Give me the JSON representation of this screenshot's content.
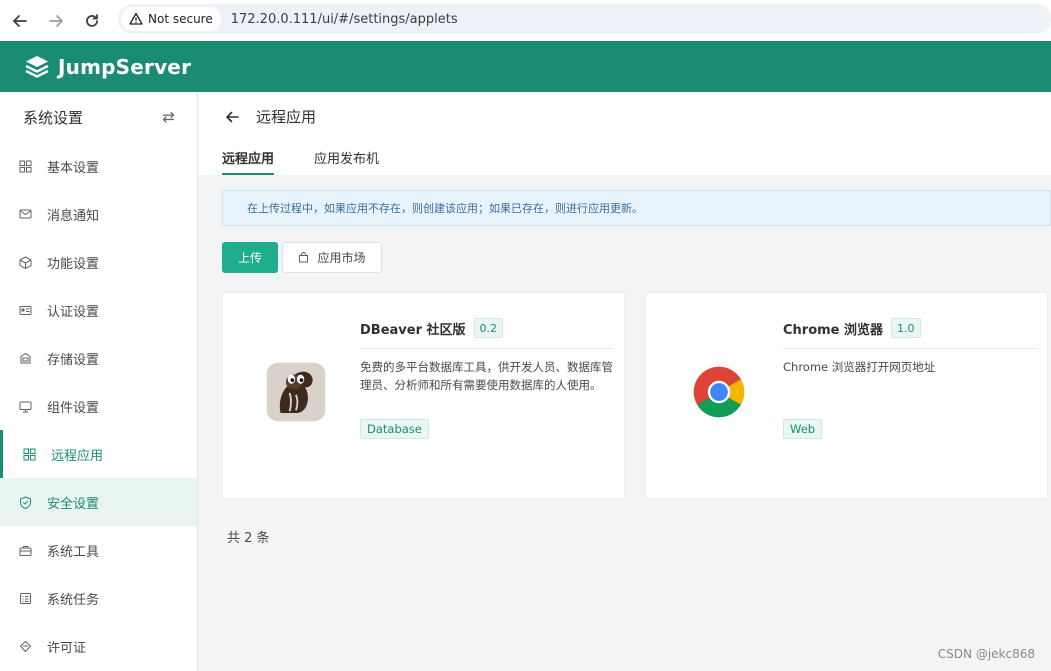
{
  "browser": {
    "security_label": "Not secure",
    "url": "172.20.0.111/ui/#/settings/applets"
  },
  "header": {
    "brand": "JumpServer"
  },
  "sidebar": {
    "title": "系统设置",
    "toggle_glyph": "⇄",
    "items": [
      {
        "label": "基本设置",
        "icon": "grid-icon"
      },
      {
        "label": "消息通知",
        "icon": "message-icon"
      },
      {
        "label": "功能设置",
        "icon": "cube-icon"
      },
      {
        "label": "认证设置",
        "icon": "id-card-icon"
      },
      {
        "label": "存储设置",
        "icon": "storage-icon"
      },
      {
        "label": "组件设置",
        "icon": "monitor-icon"
      },
      {
        "label": "远程应用",
        "icon": "apps-icon"
      },
      {
        "label": "安全设置",
        "icon": "shield-icon"
      },
      {
        "label": "系统工具",
        "icon": "toolbox-icon"
      },
      {
        "label": "系统任务",
        "icon": "task-icon"
      },
      {
        "label": "许可证",
        "icon": "license-icon"
      }
    ]
  },
  "page": {
    "title": "远程应用",
    "tabs": [
      {
        "label": "远程应用"
      },
      {
        "label": "应用发布机"
      }
    ],
    "alert": "在上传过程中，如果应用不存在，则创建该应用；如果已存在，则进行应用更新。",
    "upload_label": "上传",
    "market_label": "应用市场",
    "total": "共 2 条"
  },
  "applets": [
    {
      "name": "DBeaver 社区版",
      "version": "0.2",
      "description": "免费的多平台数据库工具，供开发人员、数据库管理员、分析师和所有需要使用数据库的人使用。",
      "type": "Database",
      "icon": "dbeaver-icon"
    },
    {
      "name": "Chrome 浏览器",
      "version": "1.0",
      "description": "Chrome 浏览器打开网页地址",
      "type": "Web",
      "icon": "chrome-icon"
    }
  ],
  "watermark": "CSDN @jekc868",
  "colors": {
    "brand": "#1a8c74",
    "primary_button": "#1fae8d",
    "alert_bg": "#e9f3fb"
  }
}
